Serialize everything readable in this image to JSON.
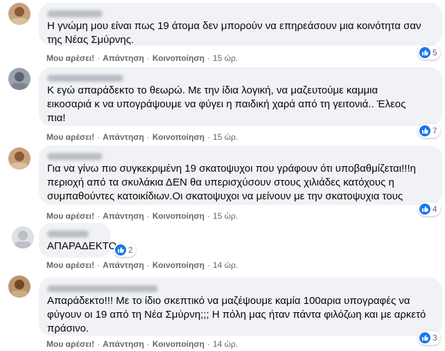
{
  "colors": {
    "bubble": "#f0f2f5",
    "like_blue": "#1877f2",
    "meta_text": "#65676b"
  },
  "actions": {
    "like": "Μου αρέσει!",
    "reply": "Απάντηση",
    "share": "Κοινοποίηση"
  },
  "comments": [
    {
      "text": "Η γνώμη μου είναι πως 19 άτομα δεν μπορούν να επηρεάσουν μια κοινότητα σαν\nτης Νέας Σμύρνης.",
      "time": "15 ώρ.",
      "reactions": "5",
      "reaction_icon": "like-icon"
    },
    {
      "text": "Κ εγώ απαράδεκτο το θεωρώ. Με την ίδια λογική, να μαζευτούμε καμμια\nεικοσαριά κ να υπογράψουμε να φύγει η παιδική χαρά από τη γειτονιά.. Έλεος\nπια!",
      "time": "15 ώρ.",
      "reactions": "7",
      "reaction_icon": "like-icon"
    },
    {
      "text": "Για να γίνω πιο συγκεκριμένη 19 σκατοψυχοι που γράφουν ότι υποβαθμίζεται!!!η\nπεριοχή από τα σκυλάκια ΔΕΝ θα υπερισχύσουν στους χιλιάδες κατόχους η\nσυμπαθούντες κατοικίδιων.Οι σκατοψυχοι να μείνουν με την σκατοψυχια τους",
      "time": "15 ώρ.",
      "reactions": "4",
      "reaction_icon": "like-icon"
    },
    {
      "text": "ΑΠΑΡΑΔΕΚΤΟ",
      "time": "14 ώρ.",
      "reactions": "2",
      "reaction_icon": "like-icon"
    },
    {
      "text": "Απαράδεκτο!!! Με το ίδιο σκεπτικό να μαζέψουμε καμία 100αρια υπογραφές να\nφύγουν οι 19 από τη Νέα Σμύρνη;;; Η πόλη μας ήταν πάντα φιλόζωη και με αρκετό\nπράσινο.",
      "time": "14 ώρ.",
      "reactions": "3",
      "reaction_icon": "like-icon"
    }
  ]
}
